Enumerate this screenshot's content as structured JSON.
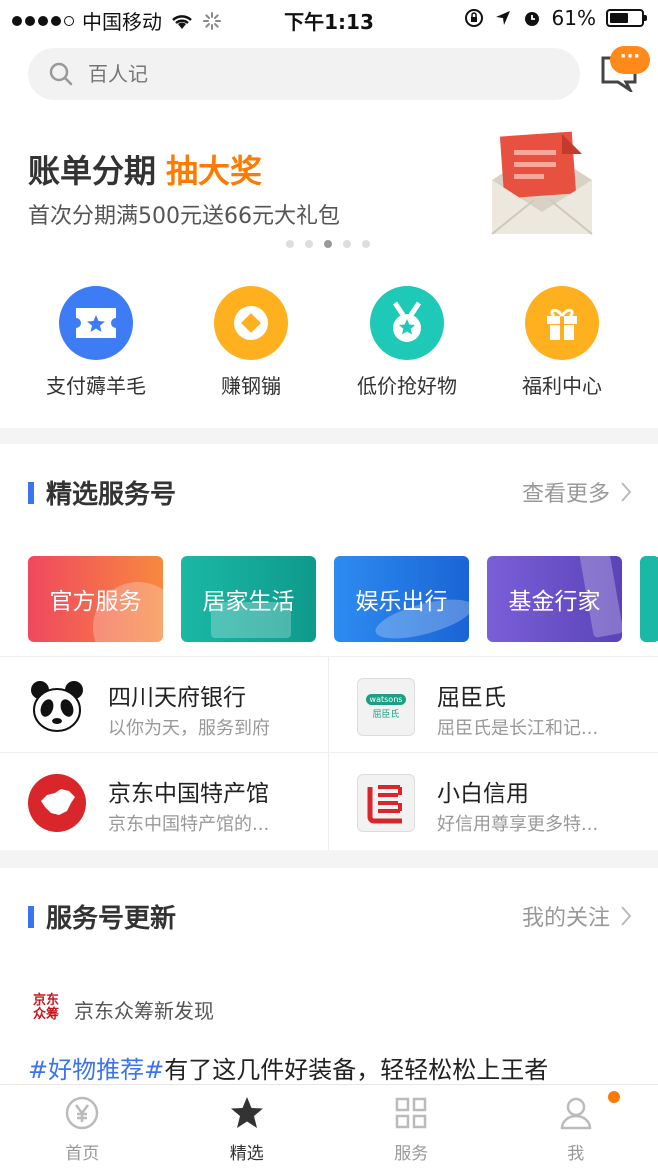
{
  "status_bar": {
    "carrier": "中国移动",
    "time": "下午1:13",
    "battery": "61%",
    "battery_level": 0.61
  },
  "search": {
    "placeholder": "百人记",
    "message_badge": "···"
  },
  "banner": {
    "title": "账单分期",
    "highlight": "抽大奖",
    "subtitle": "首次分期满500元送66元大礼包",
    "page_count": 5,
    "active_page": 2
  },
  "quick_actions": [
    {
      "label": "支付薅羊毛",
      "icon": "ticket-star-icon",
      "color": "#3d7cf5"
    },
    {
      "label": "赚钢镚",
      "icon": "coin-icon",
      "color": "#ffb01f"
    },
    {
      "label": "低价抢好物",
      "icon": "medal-star-icon",
      "color": "#1ec9b8"
    },
    {
      "label": "福利中心",
      "icon": "gift-icon",
      "color": "#ffb01f"
    }
  ],
  "services": {
    "title": "精选服务号",
    "more": "查看更多",
    "cards": [
      {
        "label": "官方服务"
      },
      {
        "label": "居家生活"
      },
      {
        "label": "娱乐出行"
      },
      {
        "label": "基金行家"
      }
    ],
    "accounts": [
      {
        "name": "四川天府银行",
        "desc": "以你为天，服务到府"
      },
      {
        "name": "屈臣氏",
        "desc": "屈臣氏是长江和记...",
        "logo_text": "watsons",
        "logo_sub": "屈臣氏"
      },
      {
        "name": "京东中国特产馆",
        "desc": "京东中国特产馆的..."
      },
      {
        "name": "小白信用",
        "desc": "好信用尊享更多特..."
      }
    ]
  },
  "updates": {
    "title": "服务号更新",
    "more": "我的关注",
    "source_logo_line1": "京东",
    "source_logo_line2": "众筹",
    "source": "京东众筹新发现",
    "tag": "#好物推荐#",
    "text": "有了这几件好装备，轻轻松松上王者"
  },
  "tabbar": [
    {
      "label": "首页",
      "icon": "yuan-coin-icon"
    },
    {
      "label": "精选",
      "icon": "star-icon"
    },
    {
      "label": "服务",
      "icon": "grid-icon"
    },
    {
      "label": "我",
      "icon": "person-icon"
    }
  ]
}
